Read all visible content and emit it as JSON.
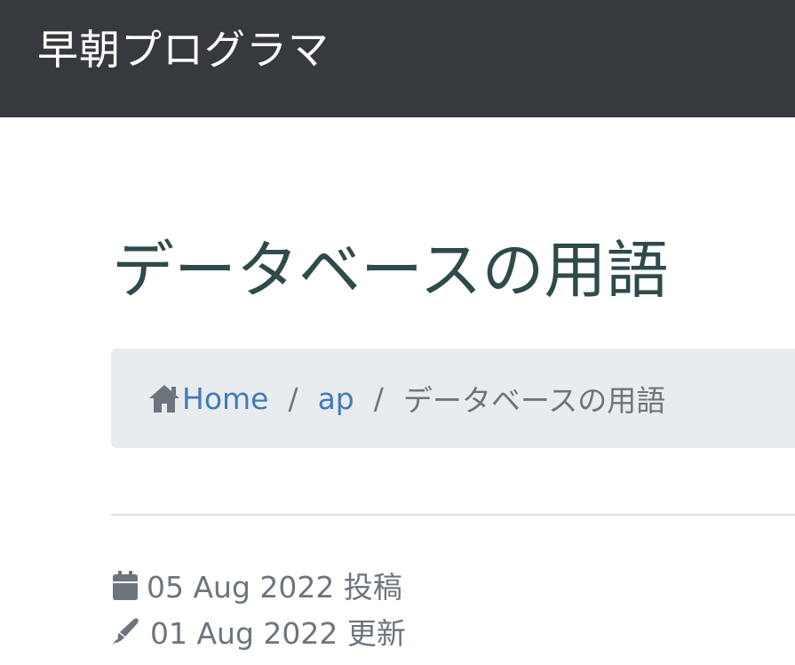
{
  "navbar": {
    "brand": "早朝プログラマ"
  },
  "page": {
    "title": "データベースの用語"
  },
  "breadcrumb": {
    "home_icon": "home-icon",
    "items": [
      {
        "label": "Home"
      },
      {
        "label": "ap"
      }
    ],
    "separator": "/",
    "current": "データベースの用語"
  },
  "meta": {
    "posted_icon": "calendar-icon",
    "posted": "05 Aug 2022 投稿",
    "updated_icon": "pen-icon",
    "updated": "01 Aug 2022 更新"
  },
  "colors": {
    "navbar_bg": "#363a3e",
    "title": "#2f4a4a",
    "link": "#3f7bb8",
    "muted": "#6c757d",
    "breadcrumb_bg": "#e9ecef"
  }
}
